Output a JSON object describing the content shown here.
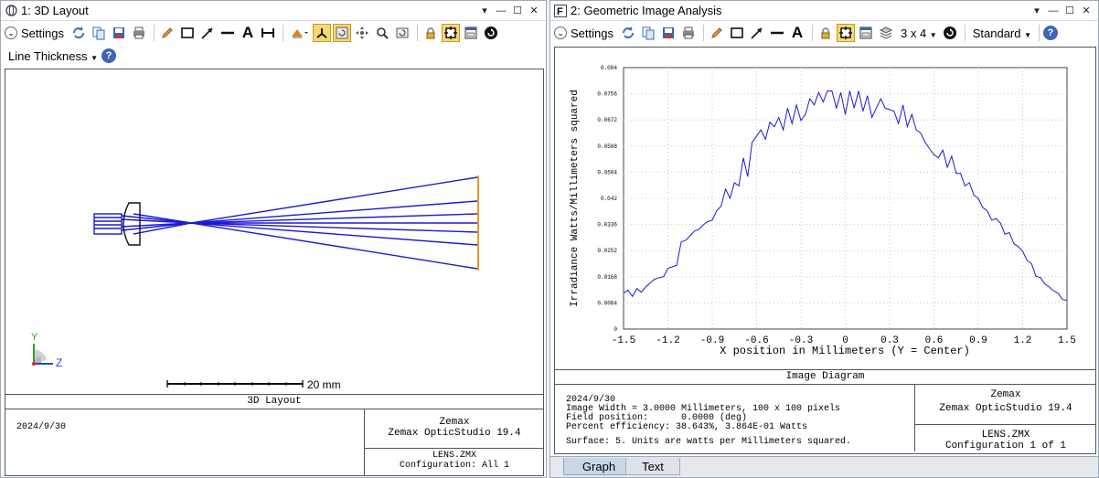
{
  "left": {
    "title": "1: 3D Layout",
    "settings_label": "Settings",
    "line_thickness_label": "Line Thickness",
    "scale_label": "20 mm",
    "axis_y": "Y",
    "axis_z": "Z",
    "footer": {
      "title": "3D Layout",
      "date": "2024/9/30",
      "brand": "Zemax",
      "product": "Zemax OpticStudio 19.4",
      "file": "LENS.ZMX",
      "config": "Configuration: All 1"
    }
  },
  "right": {
    "title": "2: Geometric Image Analysis",
    "settings_label": "Settings",
    "grid_label": "3 x 4",
    "standard_label": "Standard",
    "footer": {
      "title": "Image Diagram",
      "date": "2024/9/30",
      "line1": "Image Width = 3.0000 Millimeters, 100 x 100 pixels",
      "line2": "Field position:      0.0000 (deg)",
      "line3": "Percent efficiency: 38.643%, 3.864E-01 Watts",
      "line4": "Surface: 5. Units are watts per Millimeters squared.",
      "brand": "Zemax",
      "product": "Zemax OpticStudio 19.4",
      "file": "LENS.ZMX",
      "config": "Configuration 1 of 1"
    },
    "tabs": [
      "Graph",
      "Text"
    ]
  },
  "chart_data": {
    "type": "line",
    "title": "",
    "xlabel": "X position in Millimeters (Y = Center)",
    "ylabel": "Irradiance Watts/Millimeters squared",
    "xlim": [
      -1.5,
      1.5
    ],
    "ylim": [
      0,
      0.084
    ],
    "x_ticks": [
      "-1.5",
      "-1.2",
      "-0.9",
      "-0.6",
      "-0.3",
      "0",
      "0.3",
      "0.6",
      "0.9",
      "1.2",
      "1.5"
    ],
    "y_ticks": [
      "0",
      "0.0084",
      "0.0168",
      "0.0252",
      "0.0336",
      "0.042",
      "0.0504",
      "0.0588",
      "0.0672",
      "0.0756",
      "0.084"
    ],
    "series": [
      {
        "color": "#1a1ad4",
        "x": [
          -1.5,
          -1.47,
          -1.44,
          -1.41,
          -1.38,
          -1.35,
          -1.32,
          -1.29,
          -1.26,
          -1.23,
          -1.2,
          -1.17,
          -1.14,
          -1.11,
          -1.08,
          -1.05,
          -1.02,
          -0.99,
          -0.96,
          -0.93,
          -0.9,
          -0.87,
          -0.84,
          -0.81,
          -0.78,
          -0.75,
          -0.72,
          -0.69,
          -0.66,
          -0.63,
          -0.6,
          -0.57,
          -0.54,
          -0.51,
          -0.48,
          -0.45,
          -0.42,
          -0.39,
          -0.36,
          -0.33,
          -0.3,
          -0.27,
          -0.24,
          -0.21,
          -0.18,
          -0.15,
          -0.12,
          -0.09,
          -0.06,
          -0.03,
          0.0,
          0.03,
          0.06,
          0.09,
          0.12,
          0.15,
          0.18,
          0.21,
          0.24,
          0.27,
          0.3,
          0.33,
          0.36,
          0.39,
          0.42,
          0.45,
          0.48,
          0.51,
          0.54,
          0.57,
          0.6,
          0.63,
          0.66,
          0.69,
          0.72,
          0.75,
          0.78,
          0.81,
          0.84,
          0.87,
          0.9,
          0.93,
          0.96,
          0.99,
          1.02,
          1.05,
          1.08,
          1.11,
          1.14,
          1.17,
          1.2,
          1.23,
          1.26,
          1.29,
          1.32,
          1.35,
          1.38,
          1.41,
          1.44,
          1.47,
          1.5
        ],
        "y": [
          0.0115,
          0.0125,
          0.0105,
          0.013,
          0.0118,
          0.0135,
          0.0148,
          0.016,
          0.0165,
          0.0168,
          0.0195,
          0.02,
          0.0205,
          0.028,
          0.0285,
          0.03,
          0.0315,
          0.032,
          0.0335,
          0.0345,
          0.035,
          0.038,
          0.0395,
          0.045,
          0.042,
          0.047,
          0.046,
          0.055,
          0.049,
          0.06,
          0.062,
          0.064,
          0.061,
          0.0665,
          0.065,
          0.068,
          0.064,
          0.071,
          0.066,
          0.072,
          0.067,
          0.069,
          0.074,
          0.072,
          0.076,
          0.073,
          0.0765,
          0.0765,
          0.071,
          0.076,
          0.069,
          0.0765,
          0.071,
          0.0765,
          0.07,
          0.075,
          0.068,
          0.071,
          0.074,
          0.071,
          0.0705,
          0.07,
          0.066,
          0.072,
          0.065,
          0.069,
          0.064,
          0.063,
          0.06,
          0.058,
          0.056,
          0.055,
          0.0575,
          0.052,
          0.0555,
          0.05,
          0.05,
          0.046,
          0.047,
          0.043,
          0.042,
          0.039,
          0.038,
          0.035,
          0.0355,
          0.034,
          0.0305,
          0.031,
          0.0275,
          0.0265,
          0.025,
          0.022,
          0.021,
          0.017,
          0.0165,
          0.0145,
          0.0135,
          0.0122,
          0.0115,
          0.0095,
          0.0092
        ]
      }
    ]
  }
}
